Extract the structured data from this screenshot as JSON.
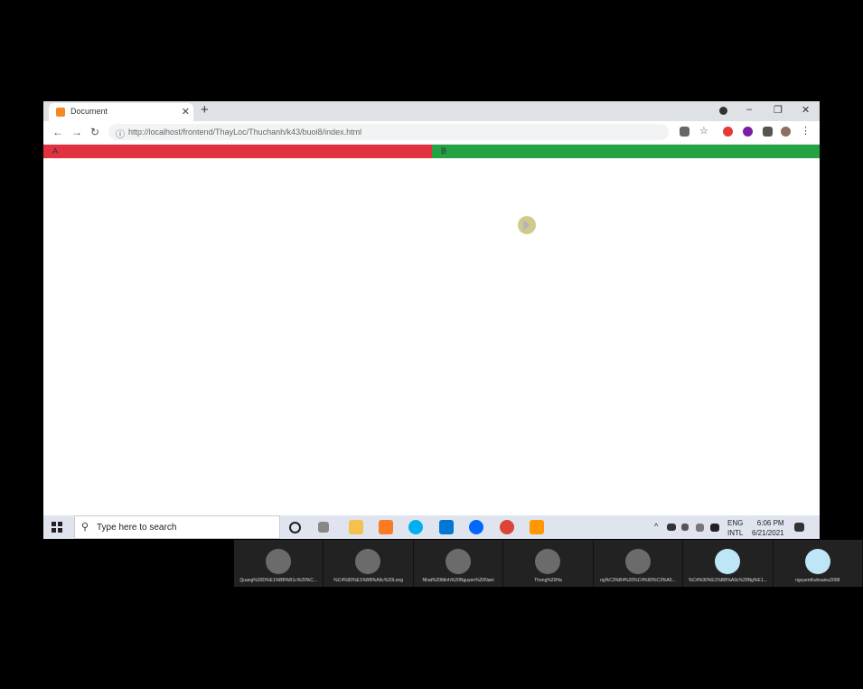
{
  "browser": {
    "tab_title": "Document",
    "close_glyph": "✕",
    "newtab_glyph": "+",
    "window_controls": [
      "–",
      "❐",
      "✕"
    ],
    "nav": {
      "back": "←",
      "forward": "→",
      "reload": "↻"
    },
    "info_glyph": "ⓘ",
    "url": "http://localhost/frontend/ThayLoc/Thuchanh/k43/buoi8/index.html"
  },
  "page": {
    "box_a_label": "A",
    "box_b_label": "B",
    "colors": {
      "box_a": "#e2323f",
      "box_b": "#25a244"
    }
  },
  "taskbar": {
    "search_placeholder": "Type here to search",
    "search_glyph": "⚲",
    "tray": {
      "chevron": "^",
      "lang_line1": "ENG",
      "lang_line2": "INTL",
      "time": "6:06 PM",
      "date": "6/21/2021"
    }
  },
  "participants": [
    {
      "name": "Quang%20D%E1%BB%B1c%20%C..."
    },
    {
      "name": "%C4%90%E1%BB%A9c%20Long"
    },
    {
      "name": "Nhat%20Minh%20Nguyen%20Nam"
    },
    {
      "name": "Thong%20Ha"
    },
    {
      "name": "ng%C3%B4%20%C4%90%C3%A0..."
    },
    {
      "name": "%C4%90%E1%BB%A9c%20Ng%E1..."
    },
    {
      "name": "nguyenthuhoaivu2008"
    }
  ]
}
